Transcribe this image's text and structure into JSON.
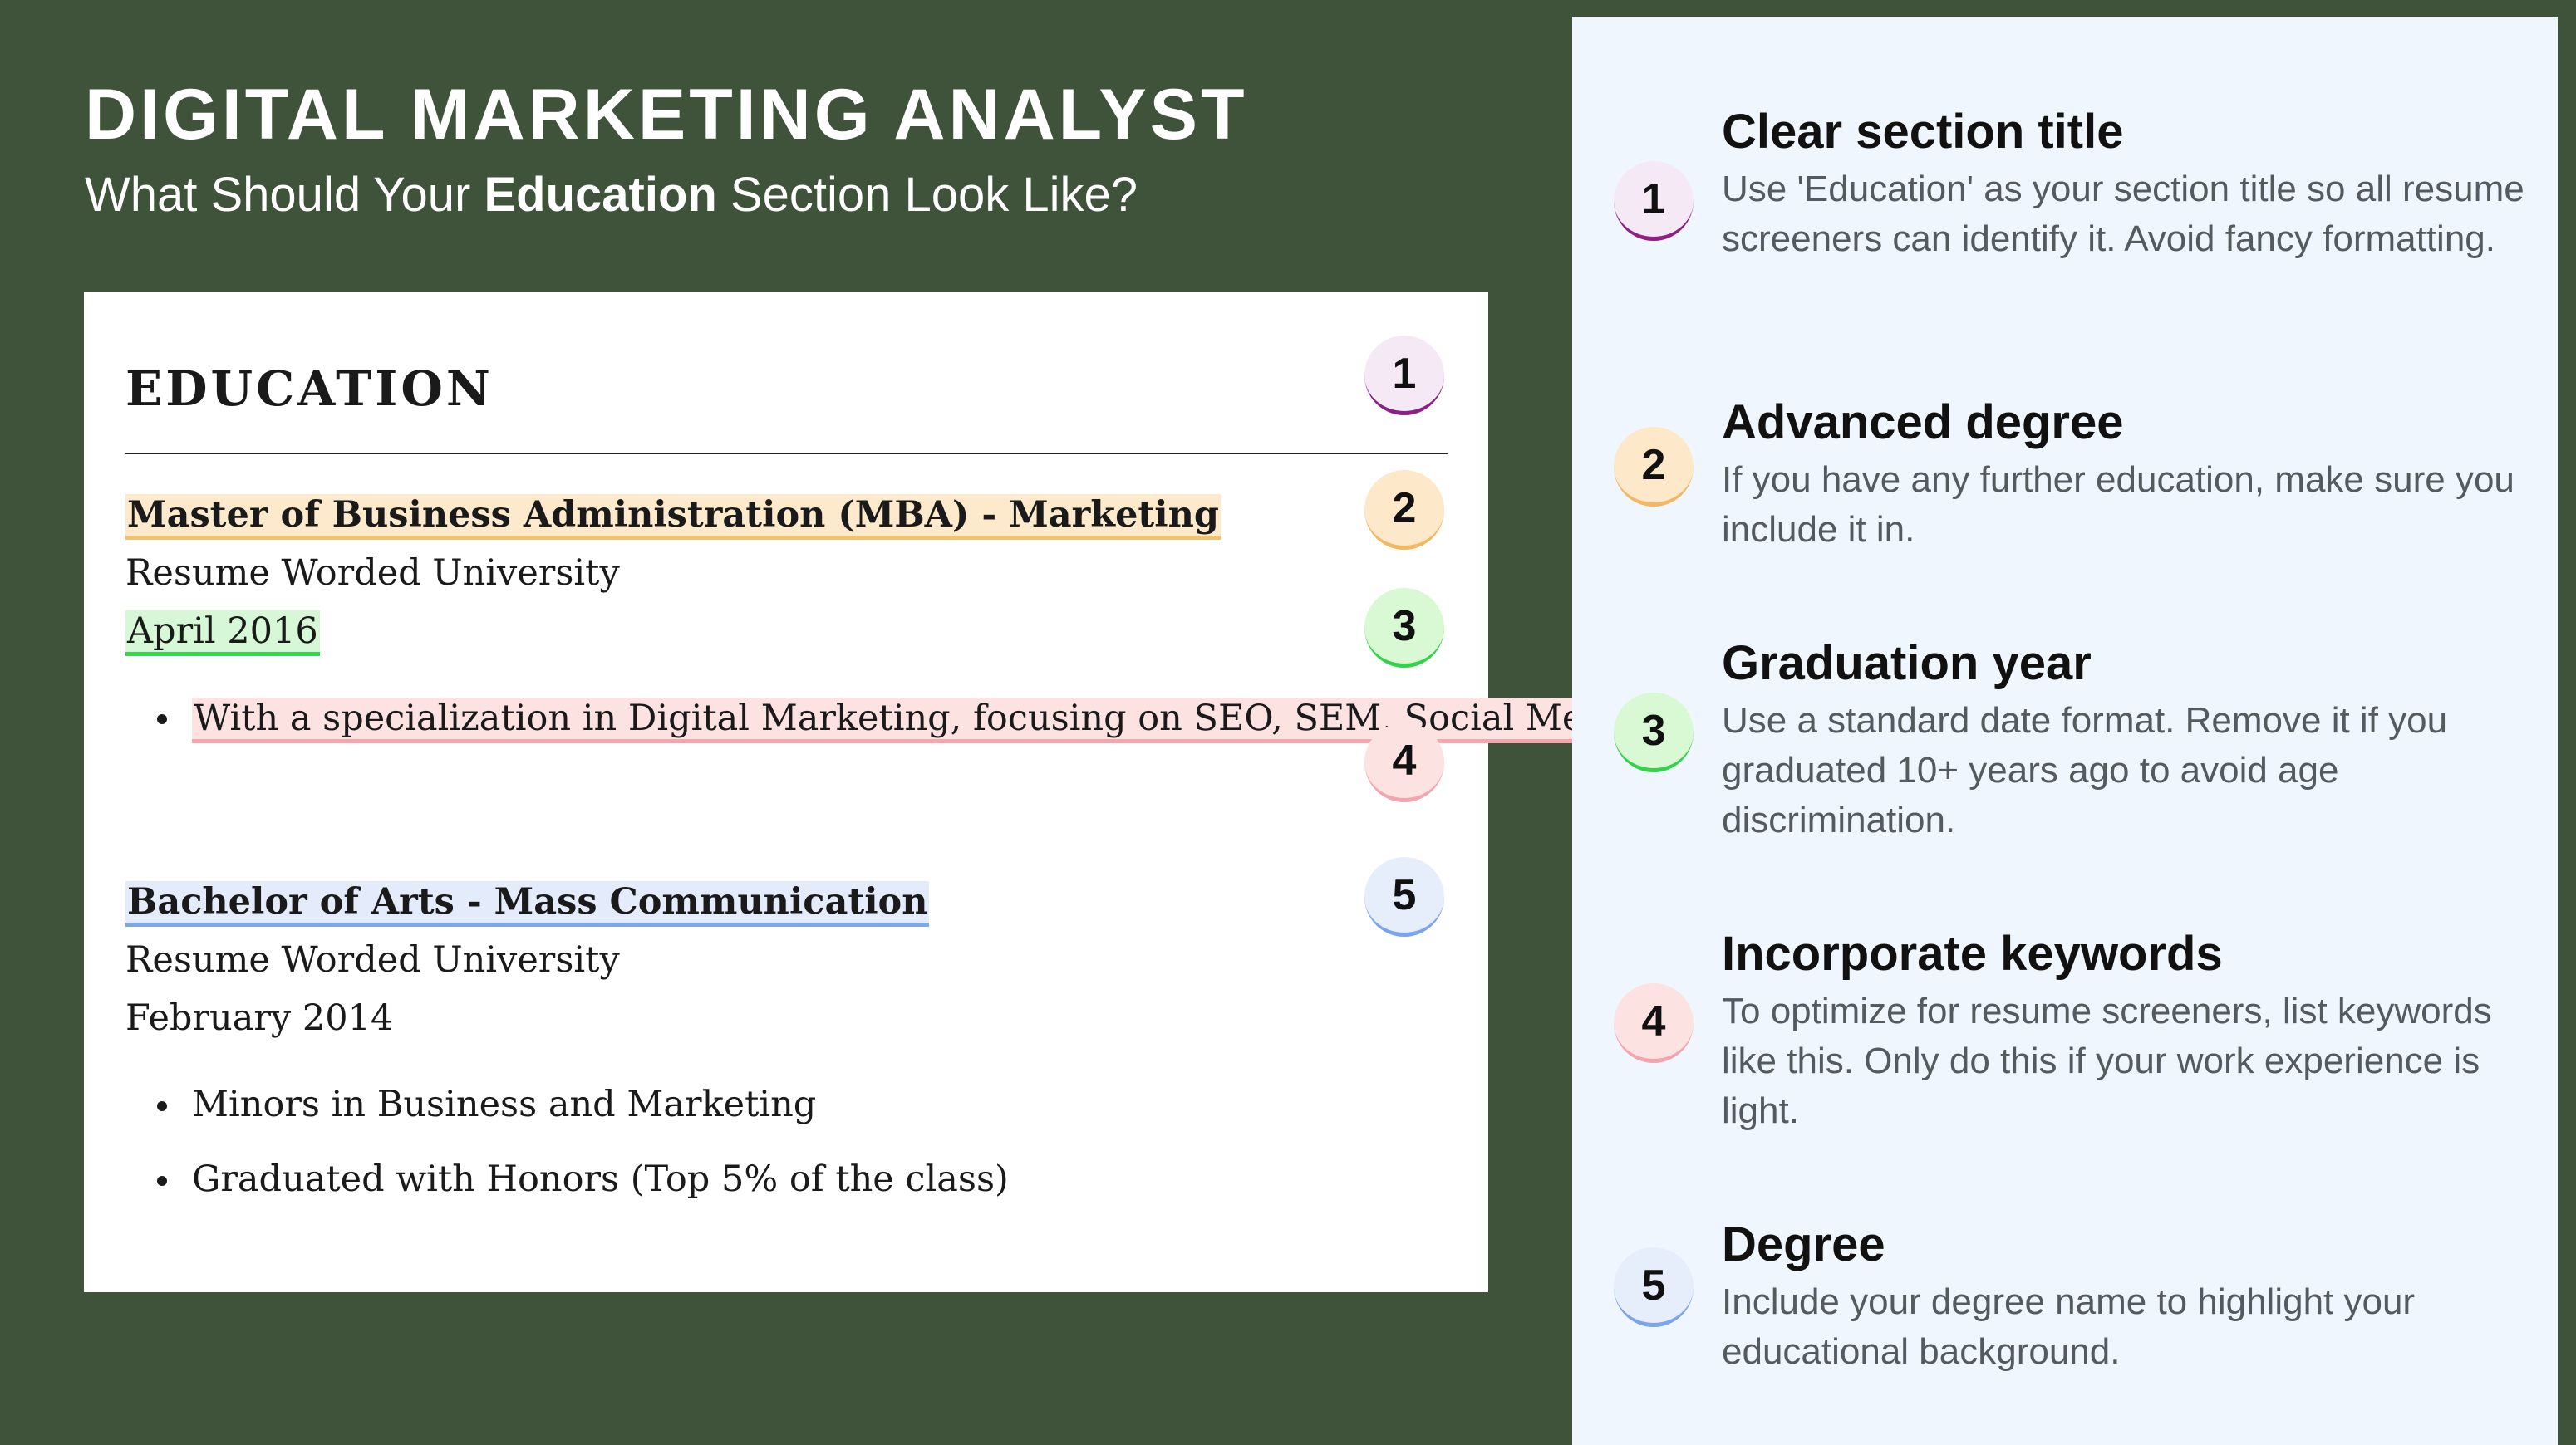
{
  "header": {
    "title": "DIGITAL MARKETING ANALYST",
    "subtitle_before": "What Should Your ",
    "subtitle_bold": "Education",
    "subtitle_after": " Section Look Like?"
  },
  "resume": {
    "section_heading": "EDUCATION",
    "entries": [
      {
        "degree": "Master of Business Administration (MBA) - Marketing",
        "school": "Resume Worded University",
        "date": "April 2016",
        "bullets": [
          "With a specialization in Digital Marketing, focusing on SEO, SEM, Social Media Marketing"
        ]
      },
      {
        "degree": "Bachelor of Arts - Mass Communication",
        "school": "Resume Worded University",
        "date": "February 2014",
        "bullets": [
          "Minors in Business and Marketing",
          "Graduated with Honors (Top 5% of the class)"
        ]
      }
    ],
    "badges": [
      "1",
      "2",
      "3",
      "4",
      "5"
    ]
  },
  "tips": [
    {
      "number": "1",
      "title": "Clear section title",
      "description": "Use 'Education' as your section title so all resume screeners can identify it. Avoid fancy formatting."
    },
    {
      "number": "2",
      "title": "Advanced degree",
      "description": "If you have any further education, make sure you include it in."
    },
    {
      "number": "3",
      "title": "Graduation year",
      "description": "Use a standard date format. Remove it if you graduated 10+ years ago to avoid age discrimination."
    },
    {
      "number": "4",
      "title": "Incorporate keywords",
      "description": "To optimize for resume screeners, list keywords like this. Only do this if your work experience is light."
    },
    {
      "number": "5",
      "title": "Degree",
      "description": "Include your degree name to highlight your educational background."
    }
  ],
  "colors": {
    "background": "#3f523a",
    "panel": "#eff6fe",
    "badge_1": "#8d1f86",
    "badge_2": "#f2b763",
    "badge_3": "#34d14a",
    "badge_4": "#f3a5ad",
    "badge_5": "#7aa5ec"
  }
}
